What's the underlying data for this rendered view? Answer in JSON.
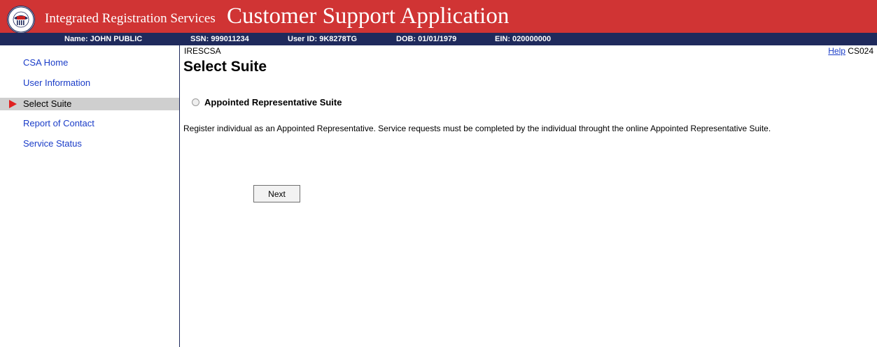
{
  "header": {
    "brand": "Integrated Registration Services",
    "app_title": "Customer Support Application",
    "logo_text": "SOCIAL SECURITY ADMINISTRATION USA"
  },
  "infobar": {
    "name": "Name: JOHN PUBLIC",
    "ssn": "SSN: 999011234",
    "user_id": "User ID: 9K8278TG",
    "dob": "DOB: 01/01/1979",
    "ein": "EIN: 020000000"
  },
  "sidebar": {
    "items": [
      {
        "label": "CSA Home"
      },
      {
        "label": "User Information"
      },
      {
        "label": "Select Suite"
      },
      {
        "label": "Report of Contact"
      },
      {
        "label": "Service Status"
      }
    ],
    "active_index": 2
  },
  "main": {
    "code": "IRESCSA",
    "help_label": "Help",
    "screen_id": "CS024",
    "title": "Select Suite",
    "option_label": "Appointed Representative Suite",
    "description": "Register individual as an Appointed Representative. Service requests must be completed by the individual throught the online Appointed Representative Suite.",
    "next_label": "Next"
  },
  "colors": {
    "banner": "#d03434",
    "infobar": "#1f2a5c",
    "link": "#1a3cc8",
    "active_nav": "#cfcfcf",
    "arrow": "#e02020"
  }
}
